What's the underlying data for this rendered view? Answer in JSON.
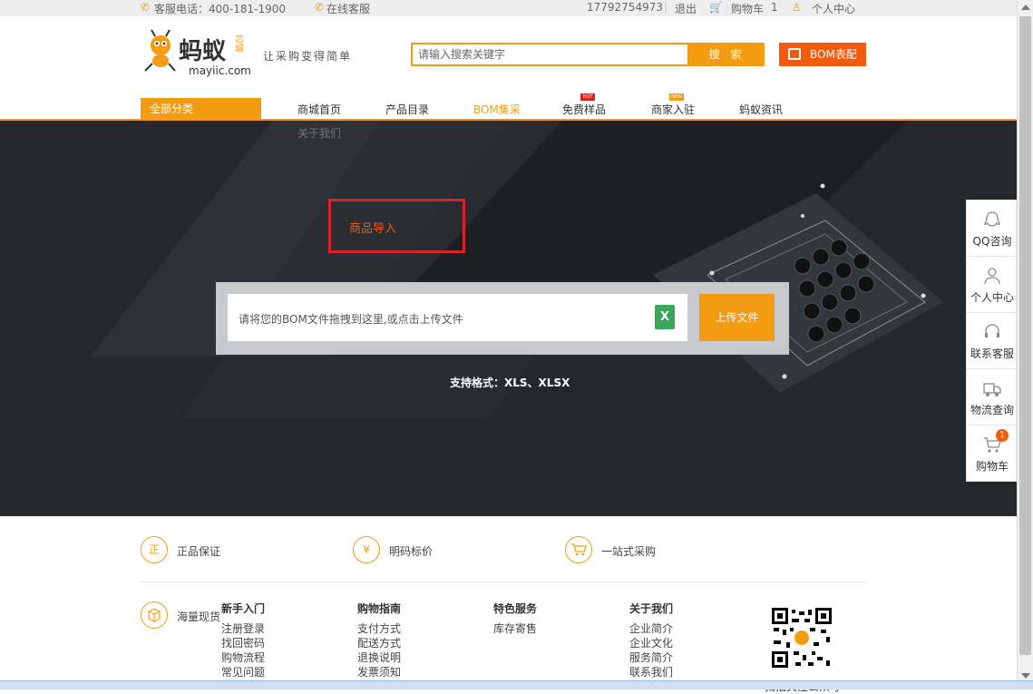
{
  "topbar": {
    "service_phone": "客服电话：400-181-1900",
    "online_service": "在线客服",
    "user_phone": "17792754973",
    "logout": "退出",
    "cart_label": "购物车",
    "cart_count": "1",
    "personal_center": "个人中心"
  },
  "header": {
    "logo_alt": "蚂蚁芯城 mayiic.com",
    "logo_text": "蚂蚁",
    "logo_sub": "芯城",
    "logo_domain": "mayiic.com",
    "slogan": "让采购变得简单",
    "search_placeholder": "请输入搜索关键字",
    "search_button": "搜 索",
    "bom_button": "BOM表配"
  },
  "nav": {
    "all_categories": "全部分类",
    "items": [
      {
        "label": "商城首页",
        "active": false
      },
      {
        "label": "产品目录",
        "active": false
      },
      {
        "label": "BOM集采",
        "active": true
      },
      {
        "label": "免费样品",
        "badge": "HOT"
      },
      {
        "label": "商家入驻",
        "badge": "NEW"
      },
      {
        "label": "蚂蚁资讯"
      }
    ],
    "about_us": "关于我们"
  },
  "hero": {
    "highlight_label": "商品导入",
    "upload_hint": "请将您的BOM文件拖拽到这里,或点击上传文件",
    "xls_icon_letter": "X",
    "upload_button": "上传文件",
    "formats": "支持格式：XLS、XLSX"
  },
  "sidebar": [
    {
      "label": "QQ咨询",
      "icon": "qq-icon"
    },
    {
      "label": "个人中心",
      "icon": "user-icon"
    },
    {
      "label": "联系客服",
      "icon": "headset-icon"
    },
    {
      "label": "物流查询",
      "icon": "truck-icon"
    },
    {
      "label": "购物车",
      "icon": "cart-icon",
      "badge": "1"
    }
  ],
  "features": [
    {
      "icon_char": "正",
      "label": "正品保证"
    },
    {
      "icon_char": "¥",
      "label": "明码标价"
    },
    {
      "icon_char": "",
      "label": "一站式采购"
    },
    {
      "icon_char": "",
      "label": "海量现货"
    }
  ],
  "footer": {
    "columns": [
      {
        "title": "新手入门",
        "links": [
          "注册登录",
          "找回密码",
          "购物流程",
          "常见问题"
        ]
      },
      {
        "title": "购物指南",
        "links": [
          "支付方式",
          "配送方式",
          "退换说明",
          "发票须知"
        ]
      },
      {
        "title": "特色服务",
        "links": [
          "库存寄售"
        ]
      },
      {
        "title": "关于我们",
        "links": [
          "企业简介",
          "企业文化",
          "服务简介",
          "联系我们"
        ]
      }
    ],
    "qr_label": "扫描关注公众号"
  },
  "colors": {
    "accent": "#f39c12",
    "bom_button": "#f25a0c",
    "highlight_border": "#d8232a",
    "hero_bg": "#24272c"
  }
}
